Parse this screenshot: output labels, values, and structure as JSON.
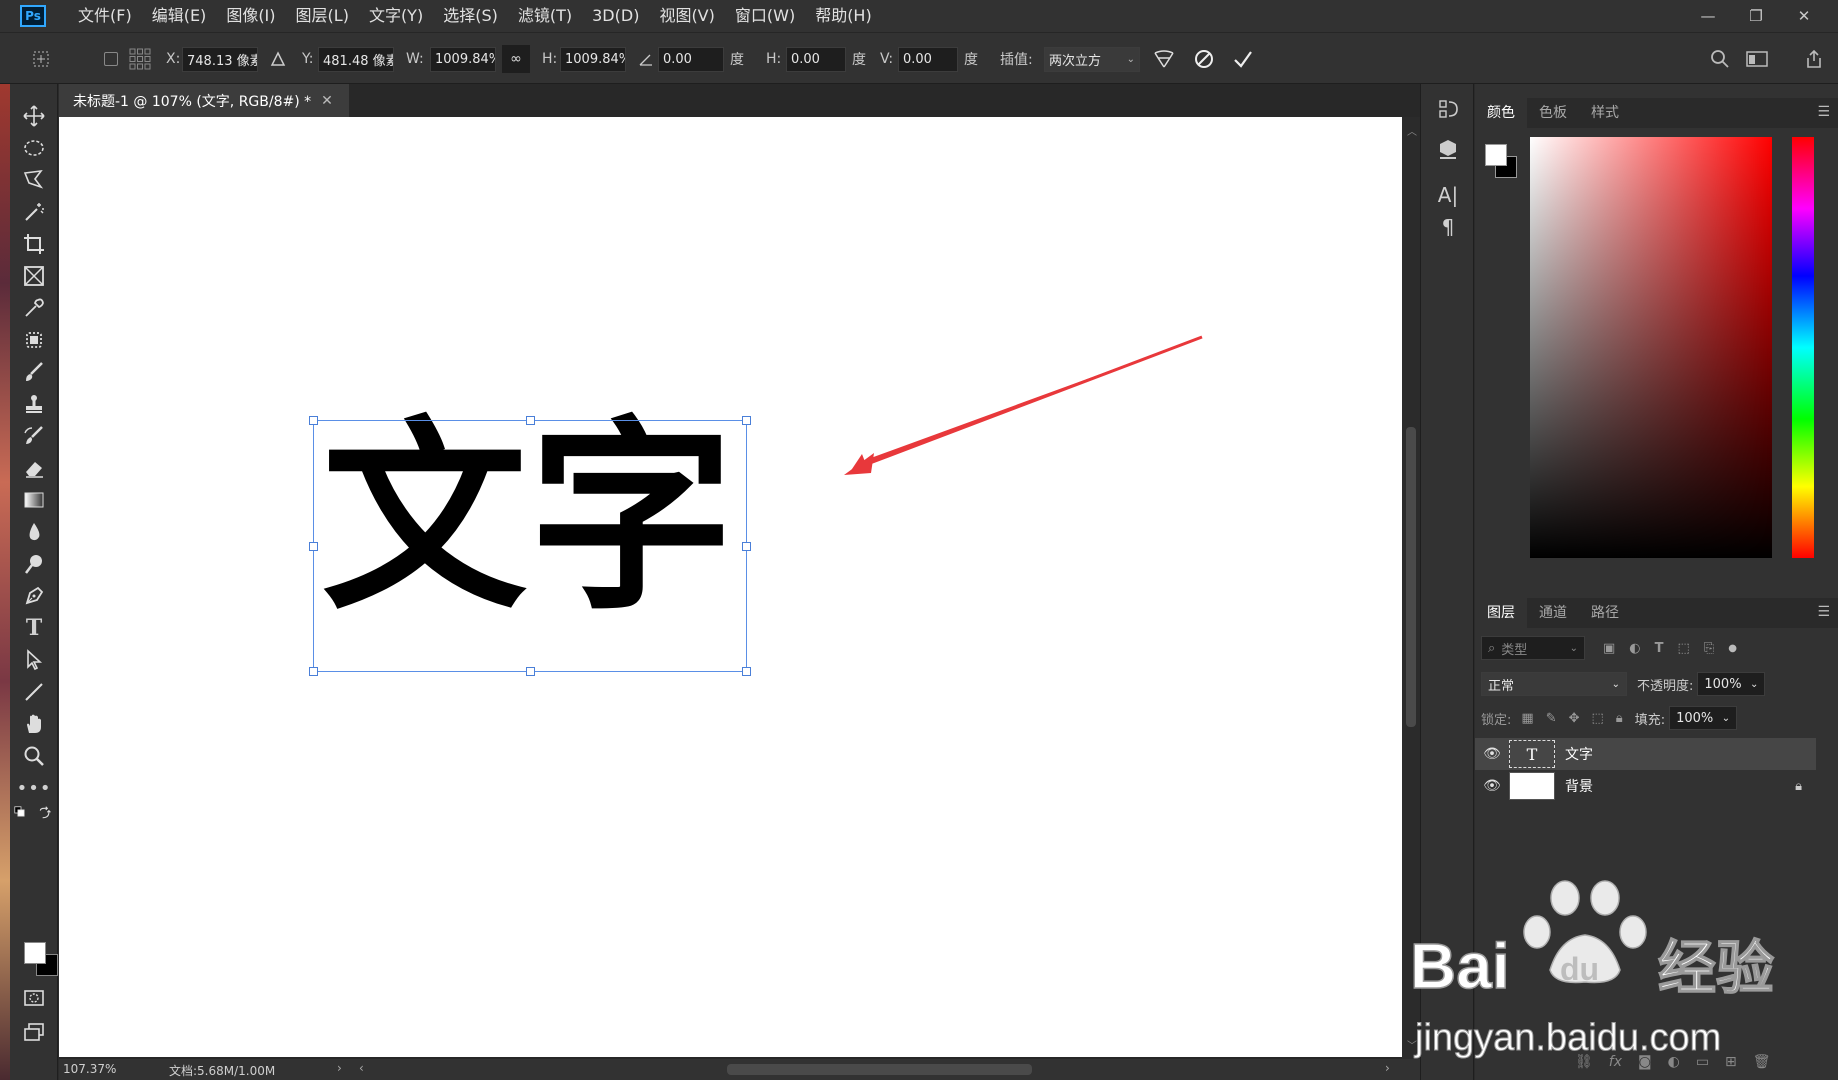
{
  "app": {
    "logo": "Ps"
  },
  "menu": [
    "文件(F)",
    "编辑(E)",
    "图像(I)",
    "图层(L)",
    "文字(Y)",
    "选择(S)",
    "滤镜(T)",
    "3D(D)",
    "视图(V)",
    "窗口(W)",
    "帮助(H)"
  ],
  "window_controls": {
    "minimize": "—",
    "restore": "❐",
    "close": "✕"
  },
  "options": {
    "x_label": "X:",
    "x_value": "748.13 像素",
    "y_label": "Y:",
    "y_value": "481.48 像素",
    "w_label": "W:",
    "w_value": "1009.84%",
    "h_label": "H:",
    "h_value": "1009.84%",
    "angle_value": "0.00",
    "deg1": "度",
    "hskew_label": "H:",
    "hskew_value": "0.00",
    "deg2": "度",
    "vskew_label": "V:",
    "vskew_value": "0.00",
    "deg3": "度",
    "interp_label": "插值:",
    "interp_value": "两次立方"
  },
  "document": {
    "tab_title": "未标题-1 @ 107% (文字, RGB/8#) *",
    "text_content": "文字",
    "zoom": "107.37%",
    "doc_size": "文档:5.68M/1.00M"
  },
  "color_panel": {
    "tabs": [
      "颜色",
      "色板",
      "样式"
    ]
  },
  "layers_panel": {
    "tabs": [
      "图层",
      "通道",
      "路径"
    ],
    "filter_placeholder": "类型",
    "blend_mode": "正常",
    "opacity_label": "不透明度:",
    "opacity_value": "100%",
    "lock_label": "锁定:",
    "fill_label": "填充:",
    "fill_value": "100%",
    "layers": [
      {
        "name": "文字",
        "type": "text",
        "thumb_glyph": "T",
        "selected": true,
        "locked": false
      },
      {
        "name": "背景",
        "type": "background",
        "thumb_glyph": "",
        "selected": false,
        "locked": true
      }
    ]
  },
  "watermark": {
    "brand": "Bai",
    "brand2": "du",
    "brand3": "经验",
    "url": "jingyan.baidu.com"
  },
  "colors": {
    "accent": "#31a8ff",
    "selection": "#5a8fe6",
    "arrow": "#e8383b"
  }
}
